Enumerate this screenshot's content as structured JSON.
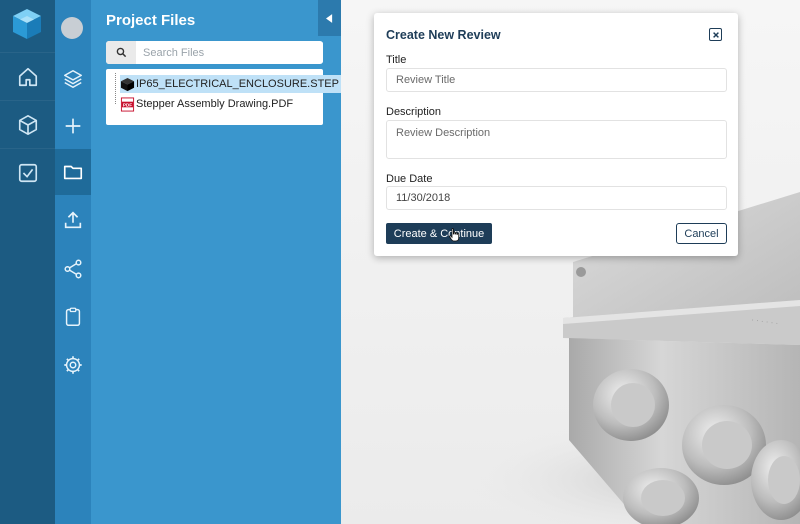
{
  "panel": {
    "title": "Project Files",
    "search_placeholder": "Search Files",
    "files": [
      {
        "name": "IP65_ELECTRICAL_ENCLOSURE.STEP",
        "icon": "cube-file-icon",
        "selected": true
      },
      {
        "name": "Stepper Assembly Drawing.PDF",
        "icon": "pdf-file-icon",
        "selected": false
      }
    ]
  },
  "modal": {
    "title": "Create New Review",
    "title_label": "Title",
    "title_placeholder": "Review Title",
    "description_label": "Description",
    "description_placeholder": "Review Description",
    "due_label": "Due Date",
    "due_value": "11/30/2018",
    "create_label": "Create & Continue",
    "cancel_label": "Cancel"
  },
  "pdf_badge": "PDF",
  "colors": {
    "rail_primary": "#1c5b82",
    "rail_secondary": "#2c83bb",
    "panel": "#3a96cd",
    "modal_accent": "#1e3d58",
    "selection": "#bfe1f7"
  }
}
